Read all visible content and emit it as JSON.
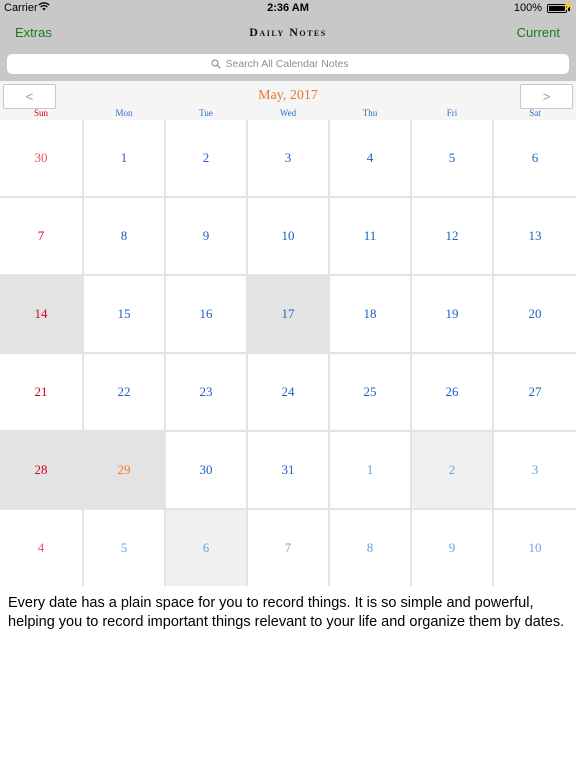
{
  "status": {
    "carrier": "Carrier",
    "time": "2:36 AM",
    "battery": "100%"
  },
  "nav": {
    "left": "Extras",
    "title": "Daily Notes",
    "right": "Current"
  },
  "search": {
    "placeholder": "Search All Calendar Notes"
  },
  "calendar": {
    "prev": "<",
    "next": ">",
    "month": "May, 2017",
    "weekdays": [
      "Sun",
      "Mon",
      "Tue",
      "Wed",
      "Thu",
      "Fri",
      "Sat"
    ],
    "weeks": [
      [
        {
          "label": "30",
          "kind": "prev-sun",
          "hl": ""
        },
        {
          "label": "1",
          "kind": "wk",
          "hl": ""
        },
        {
          "label": "2",
          "kind": "wk",
          "hl": ""
        },
        {
          "label": "3",
          "kind": "wk",
          "hl": ""
        },
        {
          "label": "4",
          "kind": "wk",
          "hl": ""
        },
        {
          "label": "5",
          "kind": "wk",
          "hl": ""
        },
        {
          "label": "6",
          "kind": "wk",
          "hl": ""
        }
      ],
      [
        {
          "label": "7",
          "kind": "sun",
          "hl": ""
        },
        {
          "label": "8",
          "kind": "wk",
          "hl": ""
        },
        {
          "label": "9",
          "kind": "wk",
          "hl": ""
        },
        {
          "label": "10",
          "kind": "wk",
          "hl": ""
        },
        {
          "label": "11",
          "kind": "wk",
          "hl": ""
        },
        {
          "label": "12",
          "kind": "wk",
          "hl": ""
        },
        {
          "label": "13",
          "kind": "wk",
          "hl": ""
        }
      ],
      [
        {
          "label": "14",
          "kind": "sun",
          "hl": "dark"
        },
        {
          "label": "15",
          "kind": "wk",
          "hl": ""
        },
        {
          "label": "16",
          "kind": "wk",
          "hl": ""
        },
        {
          "label": "17",
          "kind": "wk",
          "hl": "dark"
        },
        {
          "label": "18",
          "kind": "wk",
          "hl": ""
        },
        {
          "label": "19",
          "kind": "wk",
          "hl": ""
        },
        {
          "label": "20",
          "kind": "wk",
          "hl": ""
        }
      ],
      [
        {
          "label": "21",
          "kind": "sun",
          "hl": ""
        },
        {
          "label": "22",
          "kind": "wk",
          "hl": ""
        },
        {
          "label": "23",
          "kind": "wk",
          "hl": ""
        },
        {
          "label": "24",
          "kind": "wk",
          "hl": ""
        },
        {
          "label": "25",
          "kind": "wk",
          "hl": ""
        },
        {
          "label": "26",
          "kind": "wk",
          "hl": ""
        },
        {
          "label": "27",
          "kind": "wk",
          "hl": ""
        }
      ],
      [
        {
          "label": "28",
          "kind": "sun",
          "hl": "dark"
        },
        {
          "label": "29",
          "kind": "today",
          "hl": "dark"
        },
        {
          "label": "30",
          "kind": "wk",
          "hl": ""
        },
        {
          "label": "31",
          "kind": "wk",
          "hl": ""
        },
        {
          "label": "1",
          "kind": "other",
          "hl": ""
        },
        {
          "label": "2",
          "kind": "other",
          "hl": "light"
        },
        {
          "label": "3",
          "kind": "other",
          "hl": ""
        }
      ],
      [
        {
          "label": "4",
          "kind": "prev-sun",
          "hl": ""
        },
        {
          "label": "5",
          "kind": "other",
          "hl": ""
        },
        {
          "label": "6",
          "kind": "other",
          "hl": "light"
        },
        {
          "label": "7",
          "kind": "other",
          "hl": ""
        },
        {
          "label": "8",
          "kind": "other",
          "hl": ""
        },
        {
          "label": "9",
          "kind": "other",
          "hl": ""
        },
        {
          "label": "10",
          "kind": "other",
          "hl": ""
        }
      ]
    ]
  },
  "notes": {
    "text": "Every date has a plain space for you to record things. It is so simple and powerful, helping you to record important things relevant to your life and organize them by dates."
  },
  "colors": {
    "nav_green": "#1a7a1a",
    "month_orange": "#e8772e",
    "weekday_blue": "#1f5fc4",
    "sunday_red": "#d0021b",
    "today_orange": "#f57c1f",
    "highlight_gray": "#e3e3e3"
  }
}
